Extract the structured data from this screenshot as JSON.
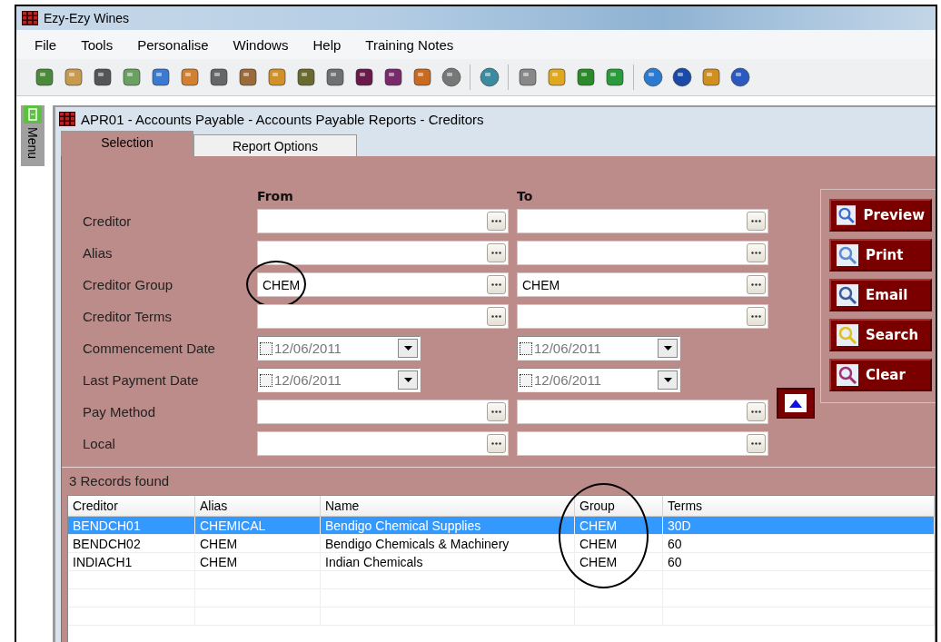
{
  "app_window": {
    "title": "Ezy-Ezy Wines"
  },
  "menu": [
    "File",
    "Tools",
    "Personalise",
    "Windows",
    "Help",
    "Training Notes"
  ],
  "sidebar": {
    "label": "Menu"
  },
  "report_window": {
    "title": "APR01 - Accounts Payable - Accounts Payable Reports -  Creditors"
  },
  "tabs": [
    {
      "label": "Selection",
      "selected": true
    },
    {
      "label": "Report Options",
      "selected": false
    }
  ],
  "form": {
    "from_heading": "From",
    "to_heading": "To",
    "rows": [
      {
        "label": "Creditor",
        "kind": "lookup",
        "from": {},
        "to": {}
      },
      {
        "label": "Alias",
        "kind": "lookup",
        "from": {},
        "to": {}
      },
      {
        "label": "Creditor Group",
        "kind": "lookup",
        "from": {
          "value": "CHEM",
          "circled": true
        },
        "to": {
          "value": "CHEM"
        }
      },
      {
        "label": "Creditor Terms",
        "kind": "lookup",
        "from": {},
        "to": {}
      },
      {
        "label": "Commencement Date",
        "kind": "date",
        "from": {
          "value": "12/06/2011",
          "checked": false
        },
        "to": {
          "value": "12/06/2011",
          "checked": false
        }
      },
      {
        "label": "Last Payment Date",
        "kind": "date",
        "from": {
          "value": "12/06/2011",
          "checked": false
        },
        "to": {
          "value": "12/06/2011",
          "checked": false
        }
      },
      {
        "label": "Pay Method",
        "kind": "lookup",
        "from": {},
        "to": {}
      },
      {
        "label": "Local",
        "kind": "lookup",
        "from": {},
        "to": {}
      }
    ]
  },
  "actions": [
    {
      "label": "Preview",
      "kind": "preview"
    },
    {
      "label": "Print",
      "kind": "print"
    },
    {
      "label": "Email",
      "kind": "email"
    },
    {
      "label": "Search",
      "kind": "search"
    },
    {
      "label": "Clear",
      "kind": "clear"
    }
  ],
  "records_found": "3 Records found",
  "table": {
    "columns": [
      {
        "label": "Creditor"
      },
      {
        "label": "Alias"
      },
      {
        "label": "Name"
      },
      {
        "label": "Group",
        "circled": true
      },
      {
        "label": "Terms"
      }
    ],
    "rows": [
      {
        "cells": [
          "BENDCH01",
          "CHEMICAL",
          "Bendigo Chemical Supplies",
          "CHEM",
          "30D"
        ],
        "selected": true
      },
      {
        "cells": [
          "BENDCH02",
          "CHEM",
          "Bendigo Chemicals & Machinery",
          "CHEM",
          "60"
        ],
        "selected": false
      },
      {
        "cells": [
          "INDIACH1",
          "CHEM",
          "Indian Chemicals",
          "CHEM",
          "60"
        ],
        "selected": false
      }
    ]
  }
}
